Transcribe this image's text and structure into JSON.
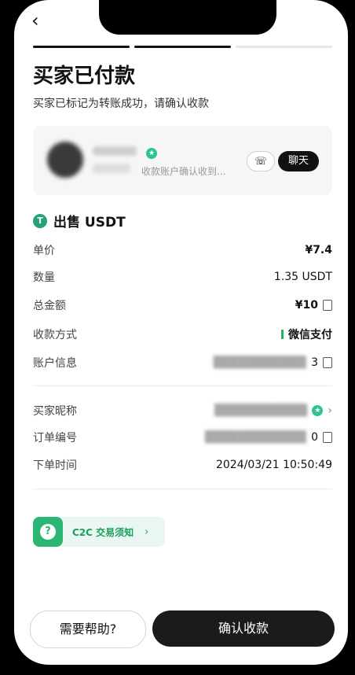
{
  "header": {
    "back_icon": "chevron-left-icon",
    "title": "买家已付款",
    "subtitle": "买家已标记为转账成功，请确认收款"
  },
  "progress": {
    "steps": 3,
    "active": 2
  },
  "buyer_card": {
    "hint": "收款账户确认收到...",
    "call_icon": "phone-icon",
    "chat_label": "聊天"
  },
  "order": {
    "section_title": "出售 USDT",
    "rows": [
      {
        "label": "单价",
        "value": "¥7.4"
      },
      {
        "label": "数量",
        "value": "1.35 USDT"
      },
      {
        "label": "总金额",
        "value": "¥10"
      },
      {
        "label": "收款方式",
        "value": "微信支付"
      },
      {
        "label": "账户信息",
        "value": "3"
      }
    ],
    "rows2": [
      {
        "label": "买家昵称",
        "value": ""
      },
      {
        "label": "订单编号",
        "value": "0"
      },
      {
        "label": "下单时间",
        "value": "2024/03/21 10:50:49"
      }
    ]
  },
  "notice": {
    "label": "C2C 交易须知"
  },
  "footer": {
    "help_label": "需要帮助?",
    "confirm_label": "确认收款"
  },
  "colors": {
    "accent": "#2bb673",
    "primary_button": "#1b1b1b"
  }
}
